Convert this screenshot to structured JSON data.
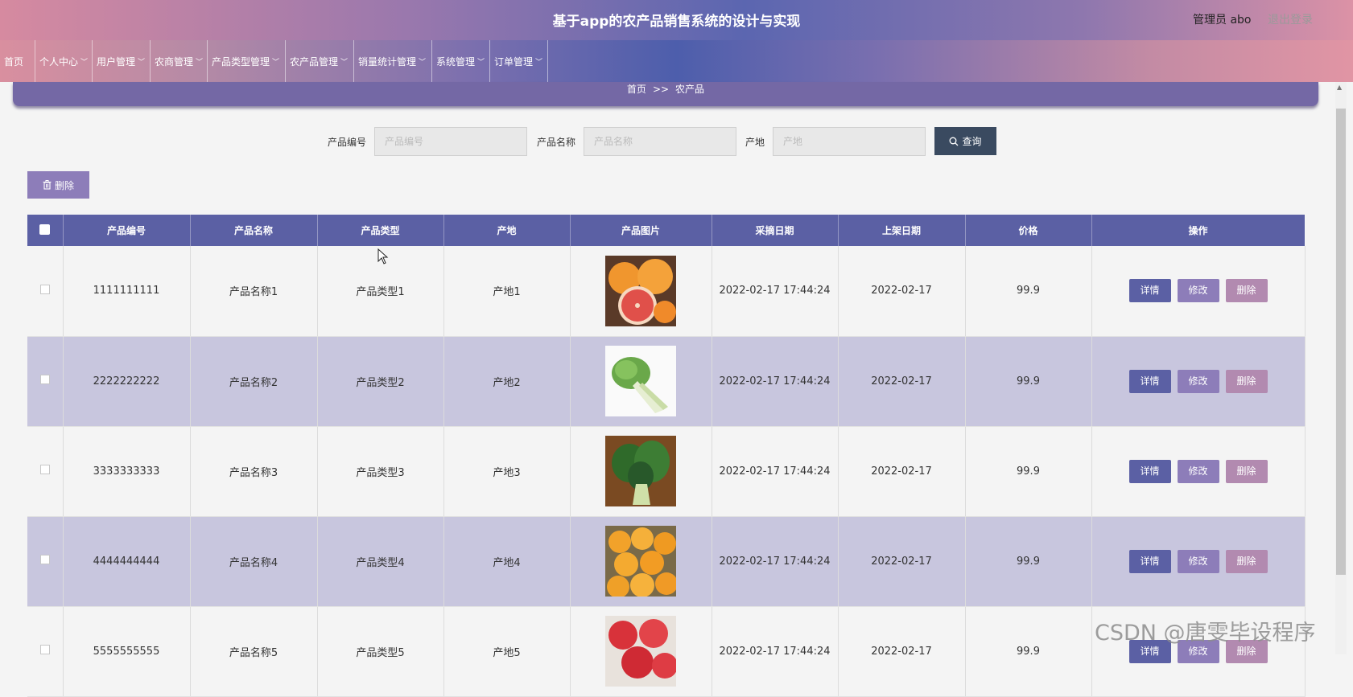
{
  "header": {
    "title": "基于app的农产品销售系统的设计与实现",
    "user": "管理员 abo",
    "logout": "退出登录"
  },
  "nav": {
    "items": [
      {
        "label": "首页",
        "dropdown": false
      },
      {
        "label": "个人中心",
        "dropdown": true
      },
      {
        "label": "用户管理",
        "dropdown": true
      },
      {
        "label": "农商管理",
        "dropdown": true
      },
      {
        "label": "产品类型管理",
        "dropdown": true
      },
      {
        "label": "农产品管理",
        "dropdown": true
      },
      {
        "label": "销量统计管理",
        "dropdown": true
      },
      {
        "label": "系统管理",
        "dropdown": true
      },
      {
        "label": "订单管理",
        "dropdown": true
      }
    ]
  },
  "breadcrumb": {
    "home": "首页",
    "separator": ">>",
    "current": "农产品"
  },
  "search": {
    "code_label": "产品编号",
    "code_placeholder": "产品编号",
    "name_label": "产品名称",
    "name_placeholder": "产品名称",
    "origin_label": "产地",
    "origin_placeholder": "产地",
    "query_label": "查询"
  },
  "toolbar": {
    "delete_label": "删除"
  },
  "table": {
    "headers": [
      "产品编号",
      "产品名称",
      "产品类型",
      "产地",
      "产品图片",
      "采摘日期",
      "上架日期",
      "价格",
      "操作"
    ],
    "actions": {
      "detail": "详情",
      "edit": "修改",
      "delete": "删除"
    },
    "rows": [
      {
        "code": "1111111111",
        "name": "产品名称1",
        "type": "产品类型1",
        "origin": "产地1",
        "image": "grapefruit",
        "pick_date": "2022-02-17 17:44:24",
        "list_date": "2022-02-17",
        "price": "99.9"
      },
      {
        "code": "2222222222",
        "name": "产品名称2",
        "type": "产品类型2",
        "origin": "产地2",
        "image": "bok-choy",
        "pick_date": "2022-02-17 17:44:24",
        "list_date": "2022-02-17",
        "price": "99.9"
      },
      {
        "code": "3333333333",
        "name": "产品名称3",
        "type": "产品类型3",
        "origin": "产地3",
        "image": "greens",
        "pick_date": "2022-02-17 17:44:24",
        "list_date": "2022-02-17",
        "price": "99.9"
      },
      {
        "code": "4444444444",
        "name": "产品名称4",
        "type": "产品类型4",
        "origin": "产地4",
        "image": "oranges",
        "pick_date": "2022-02-17 17:44:24",
        "list_date": "2022-02-17",
        "price": "99.9"
      },
      {
        "code": "5555555555",
        "name": "产品名称5",
        "type": "产品类型5",
        "origin": "产地5",
        "image": "apples",
        "pick_date": "2022-02-17 17:44:24",
        "list_date": "2022-02-17",
        "price": "99.9"
      }
    ]
  },
  "watermark": "CSDN @唐雯毕设程序",
  "icons": {
    "search": "search-icon",
    "trash": "trash-icon",
    "chevron": "chevron-down-icon"
  },
  "colors": {
    "primary": "#5b60a4",
    "secondary": "#8d7db9",
    "danger": "#b28ab0",
    "row_alt": "#c8c6de",
    "query": "#3a4a60"
  }
}
